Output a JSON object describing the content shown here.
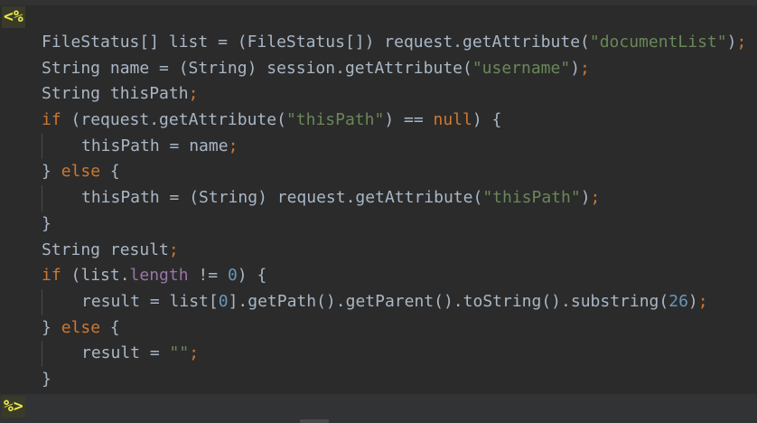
{
  "editor": {
    "delimiters": {
      "open": "<%",
      "close": "%>"
    },
    "lines": [
      {
        "indent": 0,
        "tokens": [
          {
            "t": "FileStatus[] list = (FileStatus[]) request.getAttribute(",
            "c": "plain"
          },
          {
            "t": "\"documentList\"",
            "c": "str"
          },
          {
            "t": ")",
            "c": "plain"
          },
          {
            "t": ";",
            "c": "punc"
          }
        ]
      },
      {
        "indent": 0,
        "tokens": [
          {
            "t": "String name = (String) session.getAttribute(",
            "c": "plain"
          },
          {
            "t": "\"username\"",
            "c": "str"
          },
          {
            "t": ")",
            "c": "plain"
          },
          {
            "t": ";",
            "c": "punc"
          }
        ]
      },
      {
        "indent": 0,
        "tokens": [
          {
            "t": "String thisPath",
            "c": "plain"
          },
          {
            "t": ";",
            "c": "punc"
          }
        ]
      },
      {
        "indent": 0,
        "tokens": [
          {
            "t": "if",
            "c": "kw"
          },
          {
            "t": " (request.getAttribute(",
            "c": "plain"
          },
          {
            "t": "\"thisPath\"",
            "c": "str"
          },
          {
            "t": ") == ",
            "c": "plain"
          },
          {
            "t": "null",
            "c": "kw"
          },
          {
            "t": ") {",
            "c": "plain"
          }
        ]
      },
      {
        "indent": 1,
        "tokens": [
          {
            "t": "thisPath = name",
            "c": "plain"
          },
          {
            "t": ";",
            "c": "punc"
          }
        ]
      },
      {
        "indent": 0,
        "tokens": [
          {
            "t": "} ",
            "c": "plain"
          },
          {
            "t": "else",
            "c": "kw"
          },
          {
            "t": " {",
            "c": "plain"
          }
        ]
      },
      {
        "indent": 1,
        "tokens": [
          {
            "t": "thisPath = (String) request.getAttribute(",
            "c": "plain"
          },
          {
            "t": "\"thisPath\"",
            "c": "str"
          },
          {
            "t": ")",
            "c": "plain"
          },
          {
            "t": ";",
            "c": "punc"
          }
        ]
      },
      {
        "indent": 0,
        "tokens": [
          {
            "t": "}",
            "c": "plain"
          }
        ]
      },
      {
        "indent": 0,
        "tokens": [
          {
            "t": "String result",
            "c": "plain"
          },
          {
            "t": ";",
            "c": "punc"
          }
        ]
      },
      {
        "indent": 0,
        "tokens": [
          {
            "t": "if",
            "c": "kw"
          },
          {
            "t": " (list.",
            "c": "plain"
          },
          {
            "t": "length",
            "c": "fld"
          },
          {
            "t": " != ",
            "c": "plain"
          },
          {
            "t": "0",
            "c": "num"
          },
          {
            "t": ") {",
            "c": "plain"
          }
        ]
      },
      {
        "indent": 1,
        "tokens": [
          {
            "t": "result = list[",
            "c": "plain"
          },
          {
            "t": "0",
            "c": "num"
          },
          {
            "t": "].getPath().getParent().toString().substring(",
            "c": "plain"
          },
          {
            "t": "26",
            "c": "num"
          },
          {
            "t": ")",
            "c": "plain"
          },
          {
            "t": ";",
            "c": "punc"
          }
        ]
      },
      {
        "indent": 0,
        "tokens": [
          {
            "t": "} ",
            "c": "plain"
          },
          {
            "t": "else",
            "c": "kw"
          },
          {
            "t": " {",
            "c": "plain"
          }
        ]
      },
      {
        "indent": 1,
        "tokens": [
          {
            "t": "result = ",
            "c": "plain"
          },
          {
            "t": "\"\"",
            "c": "str"
          },
          {
            "t": ";",
            "c": "punc"
          }
        ]
      },
      {
        "indent": 0,
        "tokens": [
          {
            "t": "}",
            "c": "plain"
          }
        ]
      }
    ]
  },
  "colors": {
    "background": "#2b2b2b",
    "plain": "#a9b7c6",
    "keyword": "#cc7832",
    "string": "#6a8759",
    "number": "#6897bb",
    "field": "#9876aa",
    "delimiter": "#e8e84a"
  }
}
